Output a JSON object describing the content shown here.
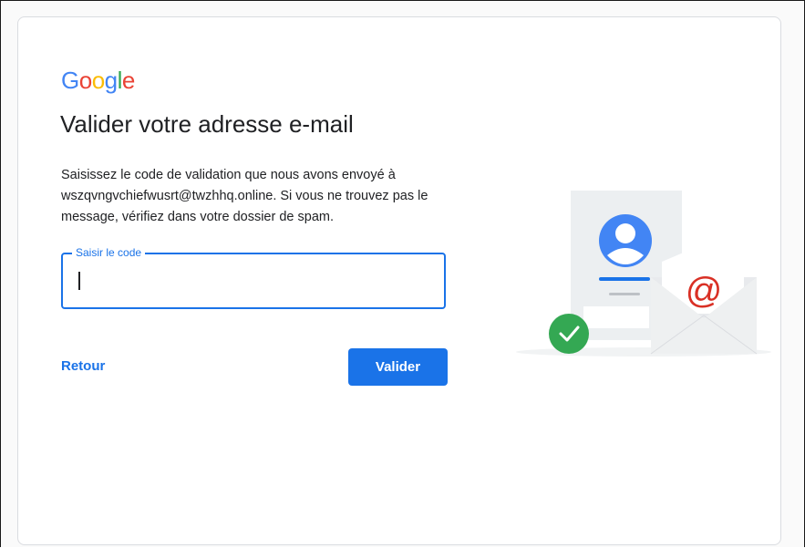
{
  "logo": {
    "letters": [
      "G",
      "o",
      "o",
      "g",
      "l",
      "e"
    ],
    "colors": [
      "#4285F4",
      "#EA4335",
      "#FBBC05",
      "#4285F4",
      "#34A853",
      "#EA4335"
    ]
  },
  "title": "Valider votre adresse e-mail",
  "description": "Saisissez le code de validation que nous avons envoyé à wszqvngvchiefwusrt@twzhhq.online. Si vous ne trouvez pas le message, vérifiez dans votre dossier de spam.",
  "code_field": {
    "label": "Saisir le code",
    "value": ""
  },
  "back_label": "Retour",
  "submit_label": "Valider",
  "illustration": {
    "icons": [
      "profile-card-icon",
      "email-envelope-icon",
      "at-sign-icon",
      "check-circle-icon"
    ],
    "at_symbol": "@"
  },
  "colors": {
    "accent": "#1a73e8",
    "success": "#34a853",
    "at_red": "#d93025"
  }
}
